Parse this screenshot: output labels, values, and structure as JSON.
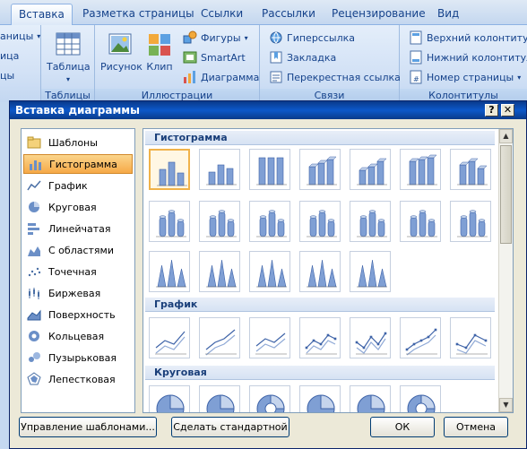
{
  "ribbon": {
    "tabs": [
      "Вставка",
      "Разметка страницы",
      "Ссылки",
      "Рассылки",
      "Рецензирование",
      "Вид"
    ],
    "left_items": [
      "аницы",
      "ица",
      "цы"
    ],
    "table_label": "Таблица",
    "tables_group": "Таблицы",
    "picture_label": "Рисунок",
    "clip_label": "Клип",
    "shapes_label": "Фигуры",
    "smartart_label": "SmartArt",
    "chart_label": "Диаграмма",
    "illustrations_group": "Иллюстрации",
    "hyperlink_label": "Гиперссылка",
    "bookmark_label": "Закладка",
    "crossref_label": "Перекрестная ссылка",
    "links_group": "Связи",
    "header_label": "Верхний колонтитул",
    "footer_label": "Нижний колонтитул",
    "pagenum_label": "Номер страницы",
    "headers_group": "Колонтитулы"
  },
  "dialog": {
    "title": "Вставка диаграммы",
    "help": "?",
    "close": "✕",
    "categories": [
      {
        "label": "Шаблоны",
        "icon": "folder-icon"
      },
      {
        "label": "Гистограмма",
        "icon": "column-chart-icon",
        "selected": true
      },
      {
        "label": "График",
        "icon": "line-chart-icon"
      },
      {
        "label": "Круговая",
        "icon": "pie-chart-icon"
      },
      {
        "label": "Линейчатая",
        "icon": "bar-chart-icon"
      },
      {
        "label": "С областями",
        "icon": "area-chart-icon"
      },
      {
        "label": "Точечная",
        "icon": "scatter-chart-icon"
      },
      {
        "label": "Биржевая",
        "icon": "stock-chart-icon"
      },
      {
        "label": "Поверхность",
        "icon": "surface-chart-icon"
      },
      {
        "label": "Кольцевая",
        "icon": "doughnut-chart-icon"
      },
      {
        "label": "Пузырьковая",
        "icon": "bubble-chart-icon"
      },
      {
        "label": "Лепестковая",
        "icon": "radar-chart-icon"
      }
    ],
    "sections": [
      {
        "title": "Гистограмма"
      },
      {
        "title": "График"
      },
      {
        "title": "Круговая"
      }
    ],
    "buttons": {
      "manage": "Управление шаблонами...",
      "set_default": "Сделать стандартной",
      "ok": "ОК",
      "cancel": "Отмена"
    }
  }
}
